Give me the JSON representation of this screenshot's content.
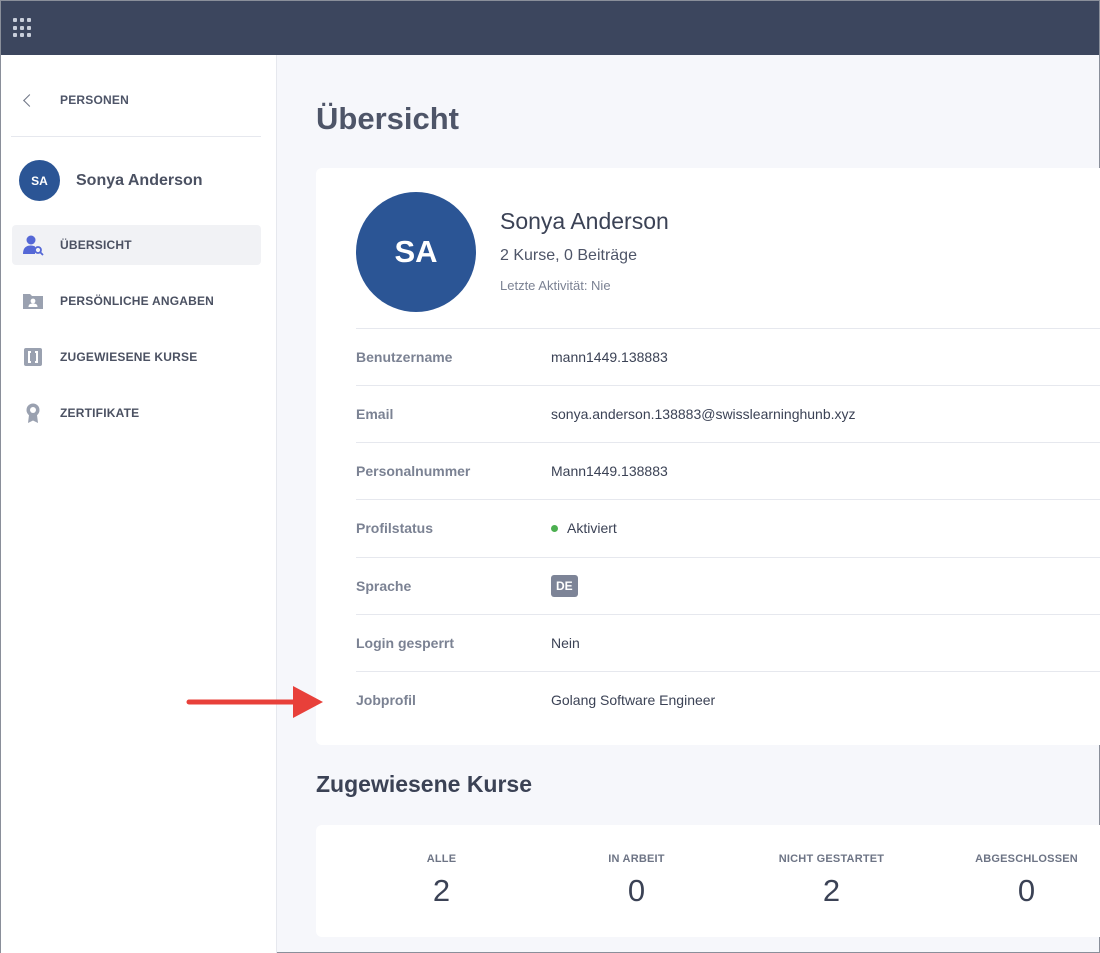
{
  "topbar": {
    "apps_icon": "apps-grid-icon"
  },
  "sidebar": {
    "back_label": "PERSONEN",
    "user": {
      "initials": "SA",
      "name": "Sonya Anderson"
    },
    "items": [
      {
        "label": "ÜBERSICHT",
        "icon": "user-search-icon",
        "active": true
      },
      {
        "label": "PERSÖNLICHE ANGABEN",
        "icon": "id-folder-icon",
        "active": false
      },
      {
        "label": "ZUGEWIESENE KURSE",
        "icon": "courses-icon",
        "active": false
      },
      {
        "label": "ZERTIFIKATE",
        "icon": "certificate-icon",
        "active": false
      }
    ]
  },
  "main": {
    "title": "Übersicht",
    "profile": {
      "initials": "SA",
      "name": "Sonya Anderson",
      "stats": "2 Kurse, 0 Beiträge",
      "last_activity": "Letzte Aktivität: Nie"
    },
    "fields": [
      {
        "label": "Benutzername",
        "value": "mann1449.138883"
      },
      {
        "label": "Email",
        "value": "sonya.anderson.138883@swisslearninghunb.xyz"
      },
      {
        "label": "Personalnummer",
        "value": "Mann1449.138883"
      },
      {
        "label": "Profilstatus",
        "value": "Aktiviert"
      },
      {
        "label": "Sprache",
        "value": "DE"
      },
      {
        "label": "Login gesperrt",
        "value": "Nein"
      },
      {
        "label": "Jobprofil",
        "value": "Golang Software Engineer"
      }
    ],
    "courses_section_title": "Zugewiesene Kurse",
    "course_stats": [
      {
        "label": "ALLE",
        "value": "2"
      },
      {
        "label": "IN ARBEIT",
        "value": "0"
      },
      {
        "label": "NICHT GESTARTET",
        "value": "2"
      },
      {
        "label": "ABGESCHLOSSEN",
        "value": "0"
      }
    ]
  },
  "colors": {
    "topbar": "#3c465e",
    "avatar": "#2b5595",
    "status_active": "#4caf50",
    "annotation_arrow": "#e8403a"
  }
}
